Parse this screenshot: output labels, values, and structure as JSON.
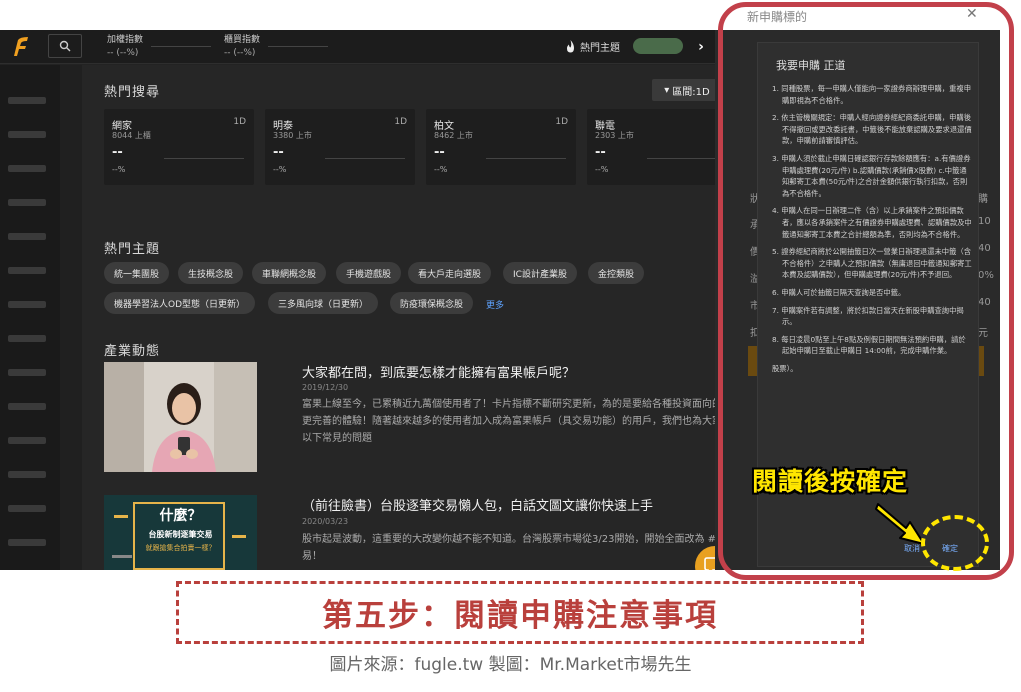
{
  "topbar": {
    "index1_label": "加權指數",
    "index1_value": "-- (--%)",
    "index2_label": "櫃買指數",
    "index2_value": "-- (--%)",
    "hot_theme_label": "熱門主題",
    "logo_icon": "fugle-logo-icon",
    "search_icon": "search-icon"
  },
  "hot_search": {
    "title": "熱門搜尋",
    "range_button": "區間:1D",
    "cards": [
      {
        "name": "網家",
        "market": "8044 上櫃",
        "period": "1D",
        "price": "--",
        "change": "--%"
      },
      {
        "name": "明泰",
        "market": "3380 上市",
        "period": "1D",
        "price": "--",
        "change": "--%"
      },
      {
        "name": "柏文",
        "market": "8462 上市",
        "period": "1D",
        "price": "--",
        "change": "--%"
      },
      {
        "name": "聯電",
        "market": "2303 上市",
        "period": "1D",
        "price": "--",
        "change": "--%"
      }
    ]
  },
  "hot_topics": {
    "title": "熱門主題",
    "tags": [
      "統一集團股",
      "生技概念股",
      "車聯網概念股",
      "手機遊戲股",
      "看大戶走向選股",
      "IC設計產業股",
      "金控類股",
      "機器學習法人OD型態（日更新）",
      "三多風向球（日更新）",
      "防疫環保概念股"
    ],
    "more": "更多"
  },
  "industry": {
    "title": "產業動態",
    "articles": [
      {
        "title": "大家都在問，到底要怎樣才能擁有富果帳戶呢？",
        "date": "2019/12/30",
        "body": "富果上線至今，已累積近九萬個使用者了！卡片指標不斷研究更新，為的是要給各種投資面向的使用者更完善的體驗！隨著越來越多的使用者加入成為富果帳戶（具交易功能）的用戶，我們也為大家整理出以下常見的問題"
      },
      {
        "title": "（前往臉書）台股逐筆交易懶人包，白話文圖文讓你快速上手",
        "date": "2020/03/23",
        "body": "股市起是波動，這重要的大改變你越不能不知道。台灣股票市場從3/23開始，開始全面改為 #逐筆交易！"
      }
    ],
    "thumb2_text": {
      "q": "什麼？",
      "l1": "台股新制逐筆交易",
      "l2": "就跟搶集合拍賣一樣？"
    }
  },
  "right_panel": {
    "title": "新申購標的",
    "close": "✕",
    "side_labels": [
      "狀",
      "承",
      "價",
      "溢",
      "市",
      "扣"
    ],
    "side_values": [
      "購",
      "10",
      "40",
      "0%",
      "40",
      "元"
    ]
  },
  "dialog": {
    "title": "我要申購 正道",
    "items": [
      "1. 同種股票，每一申購人僅能向一家證券商辦理申購，重複申購即視為不合格件。",
      "2. 依主管機關規定：申購人經向證券經紀商委託申購，申購後不得撤回或更改委託書，中籤後不能放棄認購及要求退還價款，申購前請審慎評估。",
      "3. 申購人須於截止申購日確認銀行存款餘額應有：a.有價證券申購處理費(20元/件) b.認購價款(承銷價X股數) c.中籤通知郵寄工本費(50元/件)之合計金額供銀行執行扣款，否則為不合格件。",
      "4. 申購人在同一日辦理二件（含）以上承銷案件之預扣價款者，應以各承銷案件之有價證券申購處理費、認購價款及中籤通知郵寄工本費之合計總額為準，否則均為不合格件。",
      "5. 證券經紀商將於公開抽籤日次一營業日辦理退還未中籤（含不合格件）之申購人之預扣價款（無庸退回中籤通知郵寄工本費及認購價款），但申購處理費(20元/件)不予退回。",
      "6. 申購人可於抽籤日隔天查詢是否中籤。",
      "7. 申購案件若有調整，將於扣款日當天在新股申購查詢中揭示。",
      "8. 每日凌晨0點至上午8點及例假日期間無法預約申購，請於起始申購日至截止申購日 14:00前，完成申購作業。",
      "股票）。"
    ],
    "cancel": "取消",
    "confirm": "確定"
  },
  "overlay": {
    "read_then_confirm": "閱讀後按確定",
    "step_title": "第五步：閱讀申購注意事項",
    "credit": "圖片來源：fugle.tw  製圖：Mr.Market市場先生",
    "frame_color": "#c2404a",
    "highlight_color": "#ffe600"
  }
}
